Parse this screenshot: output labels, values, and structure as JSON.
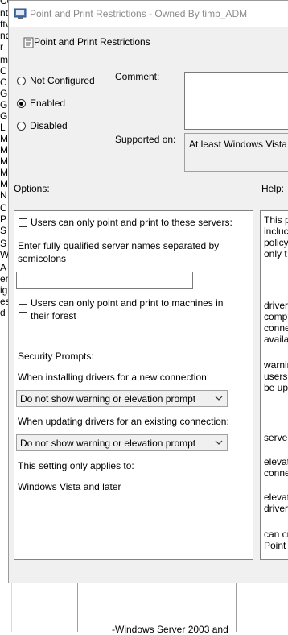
{
  "background": {
    "tree_fragments": [
      "Configuration",
      "nt",
      "ftv",
      "nd",
      "r",
      "m",
      "C",
      "C",
      "G",
      "G",
      "G",
      "L",
      "M",
      "M",
      "M",
      "M",
      "M",
      "N",
      "C",
      "P",
      "S",
      "S",
      "W",
      "A",
      "en",
      "ig",
      "es",
      "d"
    ],
    "bottom_text": "-Windows Server 2003 and"
  },
  "dialog": {
    "window_title": "Point and Print Restrictions - Owned By timb_ADM",
    "header_title": "Point and Print Restrictions",
    "radio_options": [
      {
        "label": "Not Configured",
        "selected": false
      },
      {
        "label": "Enabled",
        "selected": true
      },
      {
        "label": "Disabled",
        "selected": false
      }
    ],
    "comment_label": "Comment:",
    "comment_value": "",
    "supported_label": "Supported on:",
    "supported_value": "At least Windows Vista",
    "options_label": "Options:",
    "help_label": "Help:"
  },
  "options": {
    "checkbox_servers": {
      "label": "Users can only point and print to these servers:",
      "checked": false
    },
    "servers_hint": "Enter fully qualified server names separated by semicolons",
    "servers_value": "",
    "checkbox_forest": {
      "label": "Users can only point and print to machines in their forest",
      "checked": false
    },
    "security_prompts": "Security Prompts:",
    "new_connection_label": "When installing drivers for a new connection:",
    "new_connection_value": "Do not show warning or elevation prompt",
    "existing_connection_label": "When updating drivers for an existing connection:",
    "existing_connection_value": "Do not show warning or elevation prompt",
    "applies_label": "This setting only applies to:",
    "applies_value": "Windows Vista and later"
  },
  "help": {
    "lines": [
      "This p",
      "incluc",
      "policy",
      "only t",
      "driver",
      "comp",
      "conne",
      "availa",
      "warnin",
      "users",
      "be up",
      "server",
      "elevat",
      "conne",
      "elevat",
      "driver",
      "can cr",
      "Point"
    ]
  },
  "colors": {
    "dialog_bg": "#f0f0f0",
    "panel_bg": "#ffffff",
    "border": "#828282"
  }
}
